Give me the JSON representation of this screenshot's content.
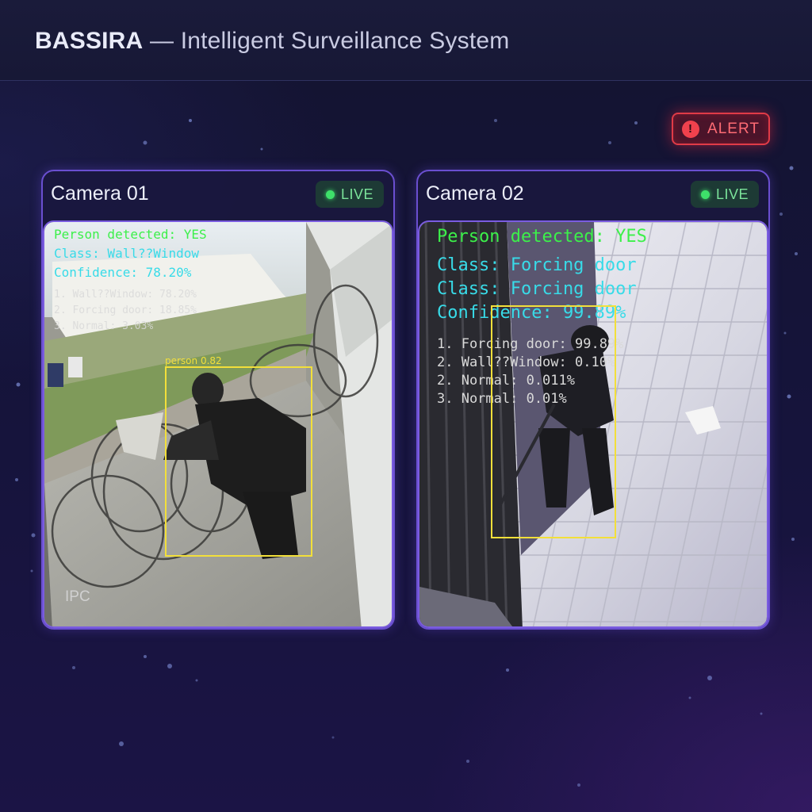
{
  "header": {
    "brand": "BASSIRA",
    "subtitle": "— Intelligent Surveillance System"
  },
  "alert": {
    "label": "ALERT",
    "icon": "alert-circle-icon",
    "color": "#e03b47"
  },
  "cameras": [
    {
      "title": "Camera 01",
      "status": "LIVE",
      "overlay": {
        "detected": "Person detected: YES",
        "class_lines": [
          "Class: Wall??Window"
        ],
        "confidence": "Confidence: 78.20%",
        "ranking": [
          "1. Wall??Window: 78.20%",
          "2. Forcing door: 18.85%",
          "3. Normal: 3.03%"
        ]
      },
      "bbox_label": "person 0.82",
      "watermark": "IPC"
    },
    {
      "title": "Camera 02",
      "status": "LIVE",
      "overlay": {
        "detected": "Person detected: YES",
        "class_lines": [
          "Class: Forcing door",
          "Class: Forcing door"
        ],
        "confidence": "Confidence: 99.89%",
        "ranking": [
          "1. Forcing door: 99.89%",
          "2. Wall??Window: 0.10%",
          "2. Normal: 0.011%",
          "3. Normal: 0.01%"
        ]
      }
    }
  ],
  "colors": {
    "accent": "#6a4fd0",
    "live": "#3ee06a",
    "detected": "#3cf04a",
    "class": "#38dbe8",
    "bbox": "#f2df3a"
  }
}
